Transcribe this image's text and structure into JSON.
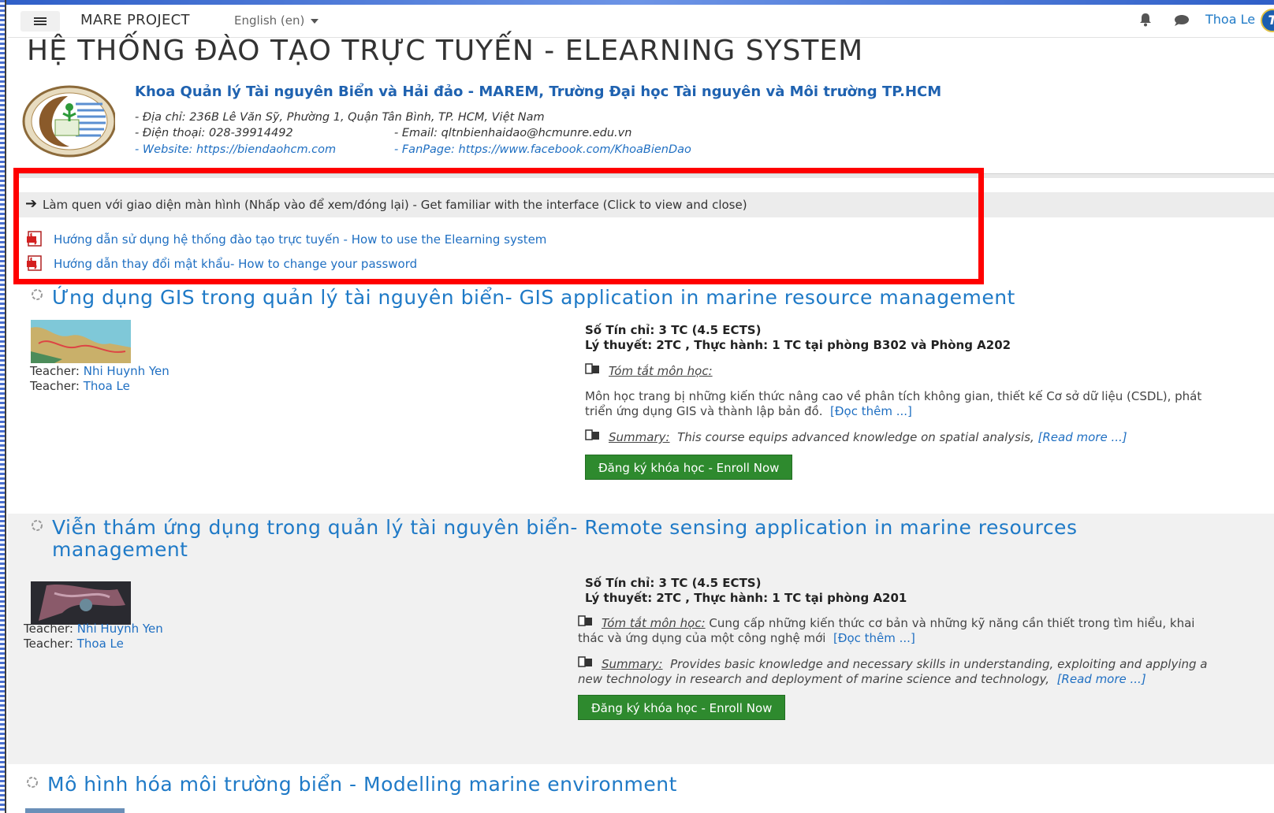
{
  "navbar": {
    "site_name": "MARE PROJECT",
    "language": "English (en)",
    "user_name": "Thoa Le",
    "avatar_initial": "T"
  },
  "page_title": "HỆ THỐNG ĐÀO TẠO TRỰC TUYẾN - ELEARNING SYSTEM",
  "faculty": {
    "name": "Khoa Quản lý Tài nguyên Biển và Hải đảo - MAREM, Trường Đại học Tài nguyên và Môi trường TP.HCM",
    "address": "- Địa chỉ: 236B Lê Văn Sỹ, Phường 1, Quận Tân Bình, TP. HCM, Việt Nam",
    "phone": "- Điện thoại: 028-39914492",
    "email": "- Email: qltnbienhaidao@hcmunre.edu.vn",
    "website_label": "- Website: ",
    "website_url": "https://biendaohcm.com",
    "fanpage_label": "- FanPage: ",
    "fanpage_url": "https://www.facebook.com/KhoaBienDao"
  },
  "familiar": {
    "arrow": "➔",
    "text": "Làm quen với giao diện màn hình (Nhấp vào để xem/đóng lại)  - Get familiar with the interface (Click to view and close)"
  },
  "guides": [
    {
      "label": "Hướng dẫn sử dụng hệ thống đào tạo trực tuyến - How to use the Elearning system",
      "icon": "pdf-icon"
    },
    {
      "label": "Hướng dẫn thay đổi mật khẩu- How to change your password",
      "icon": "pdf-icon"
    }
  ],
  "courses": [
    {
      "title": "Ứng dụng GIS trong quản lý tài nguyên biển- GIS application in marine resource management",
      "teachers": [
        {
          "role": "Teacher: ",
          "name": "Nhi Huynh Yen"
        },
        {
          "role": "Teacher: ",
          "name": "Thoa Le"
        }
      ],
      "credits": "Số Tín chỉ: 3 TC (4.5 ECTS)",
      "hours": "Lý thuyết: 2TC , Thực hành: 1 TC tại phòng B302 và Phòng A202",
      "summary_vi_label": "Tóm tắt môn học:",
      "summary_vi_line1": "Môn học trang bị những kiến thức nâng cao về phân tích không gian, thiết kế Cơ sở dữ liệu (CSDL), phát",
      "summary_vi_line2": "triển ứng dụng GIS và thành lập bản đồ.",
      "read_more_vi": "[Đọc thêm ...]",
      "summary_en_label": "Summary:",
      "summary_en_text": "This course equips advanced knowledge on spatial analysis,",
      "read_more_en": "[Read more ...]",
      "enroll": "Đăng ký khóa học - Enroll Now"
    },
    {
      "title_line1": "Viễn thám ứng dụng trong quản lý tài nguyên biển- Remote sensing application in marine resources",
      "title_line2": "management",
      "teachers": [
        {
          "role": "Teacher: ",
          "name": "Nhi Huynh Yen"
        },
        {
          "role": "Teacher: ",
          "name": "Thoa Le"
        }
      ],
      "credits": "Số Tín chỉ: 3 TC (4.5 ECTS)",
      "hours": "Lý thuyết: 2TC , Thực hành: 1 TC tại phòng A201",
      "summary_vi_label": "Tóm tắt môn học:",
      "summary_vi_line1": "Cung cấp những kiến thức cơ bản và những kỹ năng cần thiết trong tìm hiểu, khai",
      "summary_vi_line2": "thác và ứng dụng của một công nghệ mới",
      "read_more_vi": "[Đọc thêm ...]",
      "summary_en_label": "Summary:",
      "summary_en_line1": "Provides basic knowledge and necessary skills in understanding, exploiting and applying a",
      "summary_en_line2": "new technology in research and deployment of marine science and technology,",
      "read_more_en": "[Read more ...]",
      "enroll": "Đăng ký khóa học - Enroll Now"
    },
    {
      "title": "Mô hình hóa môi trường biển - Modelling marine environment"
    }
  ]
}
